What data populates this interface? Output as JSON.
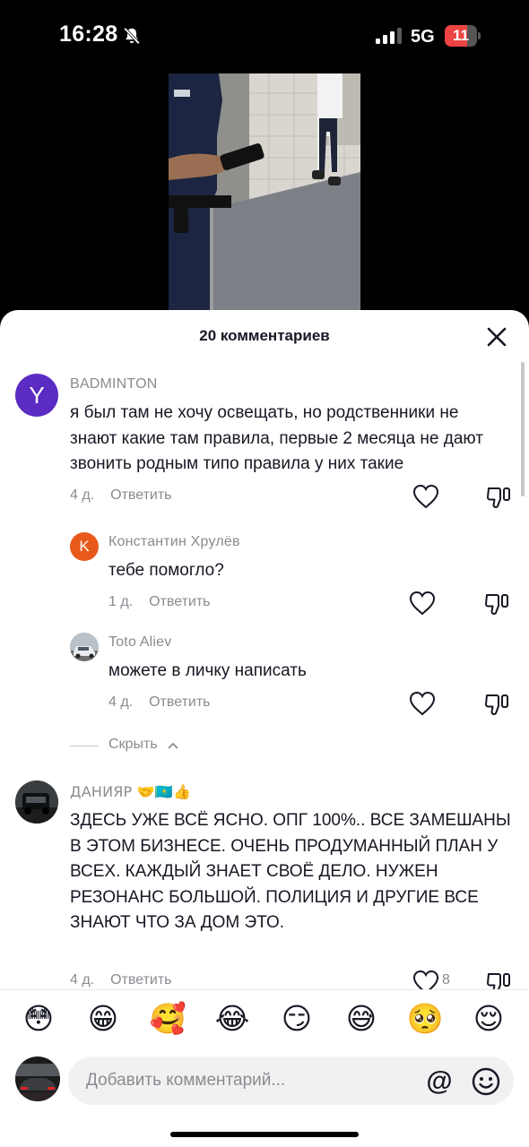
{
  "status_bar": {
    "time": "16:28",
    "network": "5G",
    "battery": "11"
  },
  "sheet": {
    "title": "20 комментариев"
  },
  "comments": [
    {
      "author": "BADMINTON",
      "avatar_letter": "Y",
      "text": "я был там не хочу освещать, но родственники не знают какие там правила, первые 2 месяца не дают звонить родным типо правила у них такие",
      "time": "4 д.",
      "reply": "Ответить"
    },
    {
      "author": "Константин Хрулёв",
      "avatar_letter": "K",
      "text": "тебе помогло?",
      "time": "1 д.",
      "reply": "Ответить"
    },
    {
      "author": "Toto Aliev",
      "text": "можете в личку написать",
      "time": "4 д.",
      "reply": "Ответить"
    },
    {
      "author": "ДАНИЯР 🤝🇰🇿👍",
      "text": "ЗДЕСЬ УЖЕ ВСЁ ЯСНО. ОПГ 100%.. ВСЕ ЗАМЕШАНЫ В ЭТОМ БИЗНЕСЕ. ОЧЕНЬ ПРОДУМАННЫЙ ПЛАН У ВСЕХ. КАЖДЫЙ ЗНАЕТ СВОЁ ДЕЛО. НУЖЕН РЕЗОНАНС БОЛЬШОЙ. ПОЛИЦИЯ И ДРУГИЕ ВСЕ ЗНАЮТ ЧТО ЗА ДОМ ЭТО.",
      "time": "4 д.",
      "reply": "Ответить",
      "likes": "8"
    }
  ],
  "hide_replies": "Скрыть",
  "emoji_bar": [
    "😳",
    "😁",
    "🥰",
    "😂",
    "😏",
    "😅",
    "🥺",
    "😌"
  ],
  "input": {
    "placeholder": "Добавить комментарий...",
    "mention": "@"
  },
  "colors": {
    "accent_y": "#5b2bc2",
    "accent_k": "#e85a1b",
    "text_secondary": "#8a8b91"
  }
}
